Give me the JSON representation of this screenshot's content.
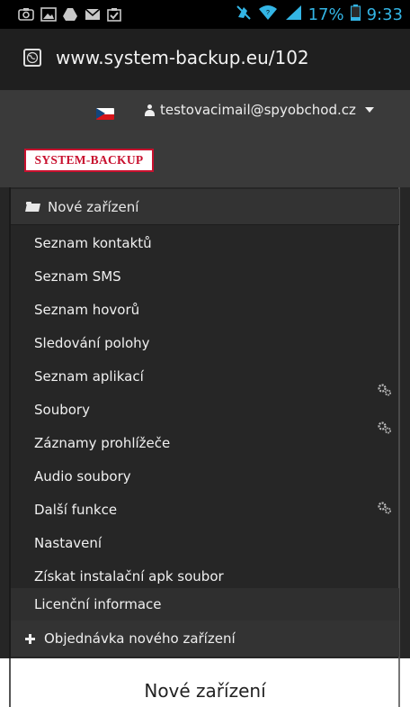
{
  "status_bar": {
    "icons_left": [
      "screenshot-icon",
      "image-icon",
      "drive-icon",
      "mail-icon",
      "clipboard-icon"
    ],
    "icons_right": [
      "mute-icon",
      "wifi-icon",
      "signal-icon",
      "battery-icon"
    ],
    "battery": "17%",
    "time": "9:33",
    "accent": "#33b5e5"
  },
  "browser": {
    "url": "www.system-backup.eu/102"
  },
  "header": {
    "user_email": "testovacimail@spyobchod.cz",
    "logo_text": "SYSTEM-BACKUP",
    "language_flag": "cz-flag-icon"
  },
  "menu": {
    "group_label": "Nové zařízení",
    "items": [
      {
        "label": "Seznam kontaktů"
      },
      {
        "label": "Seznam SMS"
      },
      {
        "label": "Seznam hovorů"
      },
      {
        "label": "Sledování polohy"
      },
      {
        "label": "Seznam aplikací"
      },
      {
        "label": "Soubory"
      },
      {
        "label": "Záznamy prohlížeče"
      },
      {
        "label": "Audio soubory"
      },
      {
        "label": "Další funkce"
      },
      {
        "label": "Nastavení"
      },
      {
        "label": "Získat instalační apk soubor"
      },
      {
        "label": "Licenční informace"
      }
    ],
    "order_label": "Objednávka nového zařízení"
  },
  "page": {
    "title": "Nové zařízení"
  },
  "colors": {
    "logo_red": "#c8102e",
    "menu_bg": "#262626",
    "header_bg": "#3a3a3a"
  }
}
